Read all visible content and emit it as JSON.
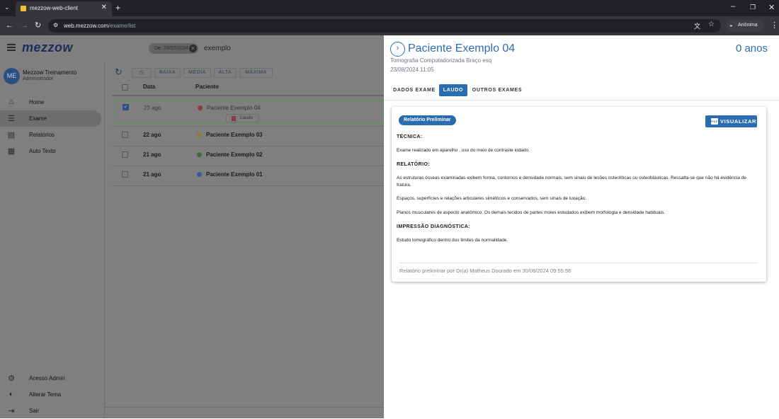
{
  "browser": {
    "tab_title": "mezzow-web-client",
    "url_host": "web.mezzow.com",
    "url_path": "/exame/list",
    "profile_label": "Anônima"
  },
  "app": {
    "logo": "mezzow",
    "filter_chip": "De: 29/02/2024",
    "search_text": "exemplo"
  },
  "user": {
    "initials": "ME",
    "name": "Mezzow Treinamento",
    "role": "Administrador"
  },
  "sidebar": {
    "items": [
      {
        "label": "Home",
        "icon": "home-icon"
      },
      {
        "label": "Exame",
        "icon": "list-icon"
      },
      {
        "label": "Relatórios",
        "icon": "report-icon"
      },
      {
        "label": "Auto Texto",
        "icon": "auto-text-icon"
      }
    ],
    "bottom_items": [
      {
        "label": "Acesso Admin",
        "icon": "gear-icon"
      },
      {
        "label": "Alterar Tema",
        "icon": "theme-icon"
      },
      {
        "label": "Sair",
        "icon": "logout-icon"
      }
    ]
  },
  "toolbar": {
    "priority_buttons": [
      "BAIXA",
      "MÉDIA",
      "ALTA",
      "MÁXIMA"
    ]
  },
  "table": {
    "headers": [
      "Data",
      "Paciente"
    ],
    "rows": [
      {
        "date": "23 ago",
        "patient": "Paciente Exemplo 04",
        "status_color": "#c62828",
        "selected": true,
        "chip": "Laudo"
      },
      {
        "date": "22 ago",
        "patient": "Paciente Exemplo 03",
        "status_color": "#f9a825",
        "selected": false
      },
      {
        "date": "21 ago",
        "patient": "Paciente Exemplo 02",
        "status_color": "#2e7d32",
        "selected": false
      },
      {
        "date": "21 ago",
        "patient": "Paciente Exemplo 01",
        "status_color": "#1565c0",
        "selected": false
      }
    ]
  },
  "panel": {
    "patient_name": "Paciente Exemplo 04",
    "age": "0 anos",
    "exam": "Tomografia Computadorizada Braço esq",
    "datetime": "23/08/2024 11:05",
    "tabs": [
      "DADOS EXAME",
      "LAUDO",
      "OUTROS EXAMES"
    ],
    "active_tab": "LAUDO"
  },
  "report": {
    "badge": "Relatório Preliminar",
    "view_button": "VISUALIZAR",
    "pdf_label": "PDF",
    "tecnica_heading": "TÉCNICA:",
    "tecnica_text": "Exame realizado em aparelho , uso do meio de contraste iodado.",
    "relatorio_heading": "RELATÓRIO:",
    "relatorio_p1": "As estruturas ósseas examinadas exibem forma, contornos e densidade normais, sem sinais de lesões osteolíticas ou osteoblásticas. Ressalta-se que não há evidência de fratura.",
    "relatorio_p2": "Espaços, superfícies e relações articulares simétricos e conservados, sem sinais de luxação.",
    "relatorio_p3": "Planos musculares de aspecto anatômico. Os demais tecidos de partes moles estudados exibem morfologia e densidade habituais.",
    "impressao_heading": "IMPRESSÃO DIAGNÓSTICA:",
    "impressao_text": "Estudo tomográfico dentro dos limites da normalidade.",
    "footer": "Relatório preliminar por Dr(a) Matheus Dourado em 30/08/2024 09:55:58"
  },
  "colors": {
    "accent": "#2b6cb0",
    "brand_dark": "#1b2e59",
    "overlay": "#7f7f7f"
  }
}
